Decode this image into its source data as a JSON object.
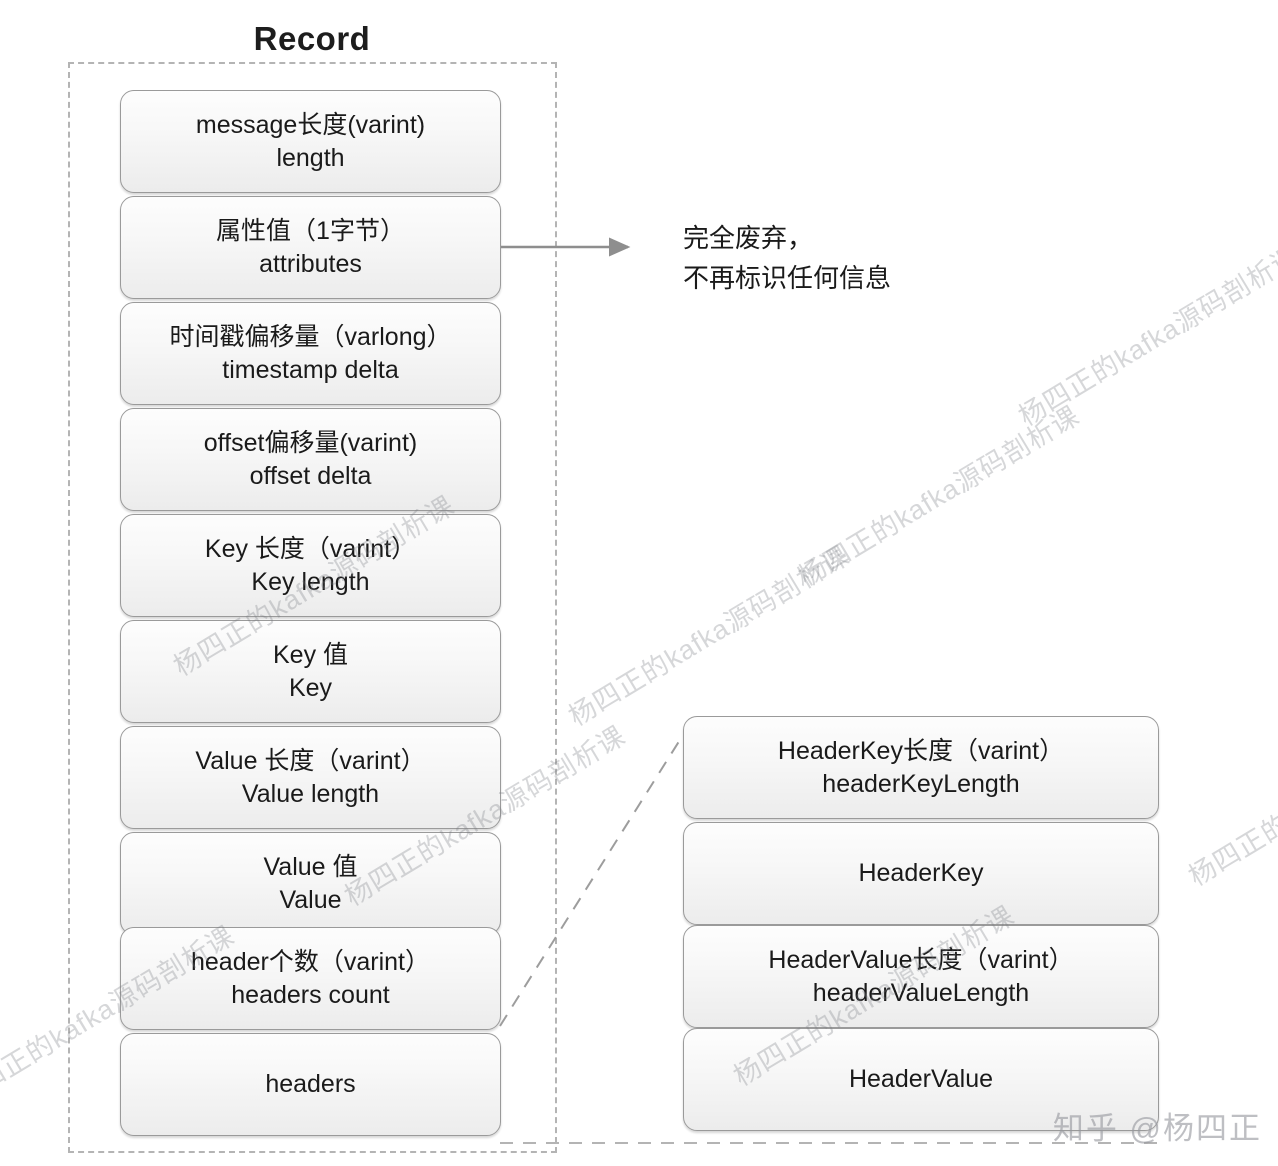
{
  "record": {
    "title": "Record",
    "fields": [
      {
        "line1": "message长度(varint)",
        "line2": "length"
      },
      {
        "line1": "属性值（1字节）",
        "line2": "attributes"
      },
      {
        "line1": "时间戳偏移量（varlong）",
        "line2": "timestamp delta"
      },
      {
        "line1": "offset偏移量(varint)",
        "line2": "offset delta"
      },
      {
        "line1": "Key 长度（varint）",
        "line2": "Key length"
      },
      {
        "line1": "Key 值",
        "line2": "Key"
      },
      {
        "line1": "Value 长度（varint）",
        "line2": "Value length"
      },
      {
        "line1": "Value 值",
        "line2": "Value"
      },
      {
        "line1": "header个数（varint）",
        "line2": "headers count"
      },
      {
        "line1": "headers",
        "line2": ""
      }
    ]
  },
  "headers_detail": {
    "fields": [
      {
        "line1": "HeaderKey长度（varint）",
        "line2": "headerKeyLength"
      },
      {
        "line1": "HeaderKey",
        "line2": ""
      },
      {
        "line1": "HeaderValue长度（varint）",
        "line2": "headerValueLength"
      },
      {
        "line1": "HeaderValue",
        "line2": ""
      }
    ]
  },
  "annotation": {
    "discard_line1": "完全废弃，",
    "discard_line2": "不再标识任何信息"
  },
  "attribution": {
    "text": "知乎 @杨四正"
  },
  "watermark": {
    "text": "杨四正的kafka源码剖析课"
  },
  "colors": {
    "box_border": "#9a9a9a",
    "dashed_border": "#b4b4b4",
    "connector": "#8e8e8e",
    "text": "#1a1a1a",
    "watermark": "rgba(120,122,128,0.30)"
  }
}
